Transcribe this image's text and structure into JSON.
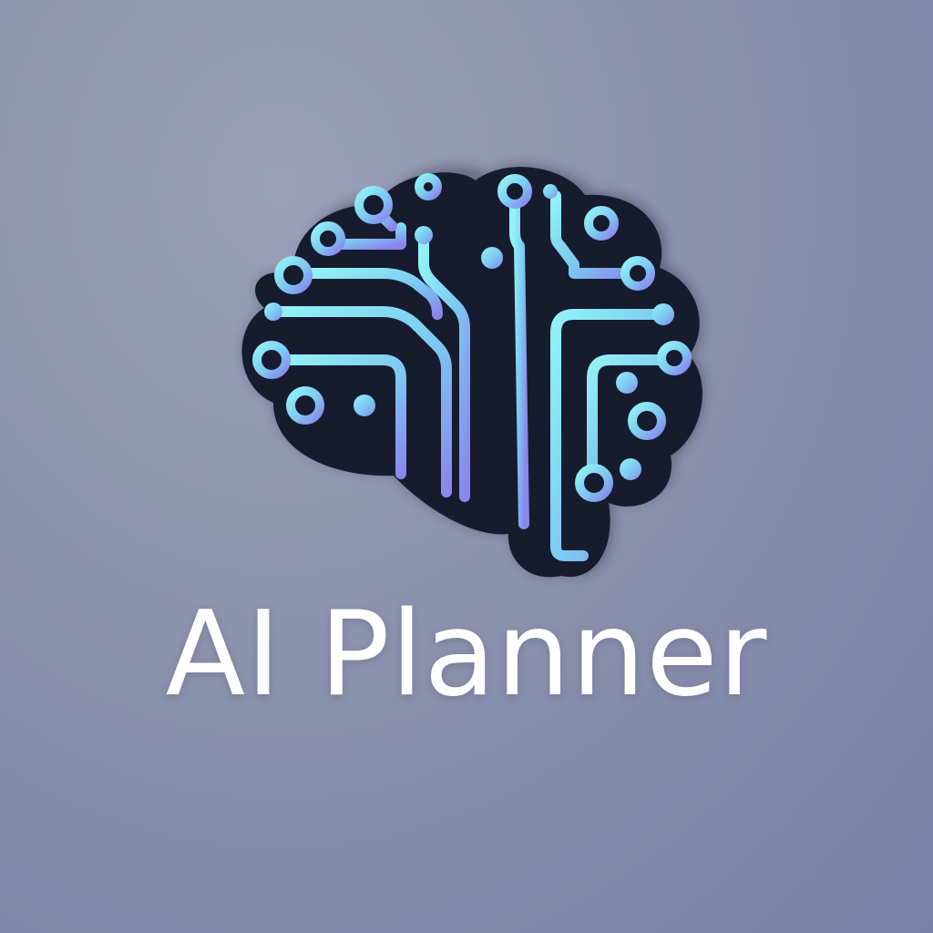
{
  "brand": {
    "name": "AI Planner"
  },
  "logo": {
    "icon": "brain-circuit-icon",
    "colors": {
      "background": "#8c91ad",
      "brain_fill": "#161b2e",
      "circuit_light": "#8ff0f4",
      "circuit_mid": "#7cc6f2",
      "circuit_dark": "#8a8ef0"
    }
  }
}
